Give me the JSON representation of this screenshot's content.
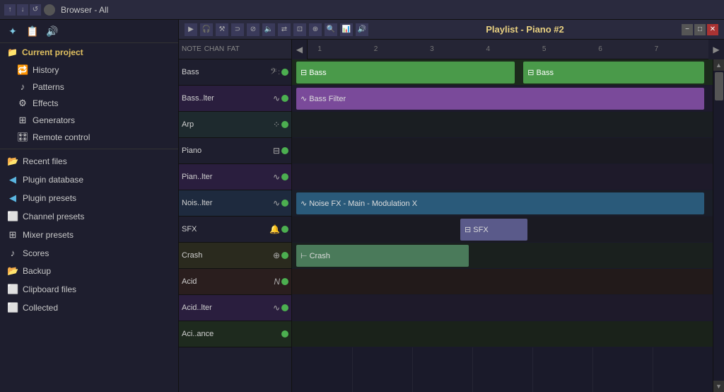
{
  "topbar": {
    "title": "Browser - All",
    "arrows": [
      "↑",
      "↓",
      "↺"
    ],
    "icons": [
      "⊕"
    ]
  },
  "sidebar": {
    "header_icons": [
      "✦",
      "📄",
      "🔊"
    ],
    "current_project_label": "Current project",
    "project_items": [
      {
        "label": "History",
        "icon": "🔁"
      },
      {
        "label": "Patterns",
        "icon": "♪"
      },
      {
        "label": "Effects",
        "icon": "⚙"
      },
      {
        "label": "Generators",
        "icon": "⊞"
      },
      {
        "label": "Remote control",
        "icon": "🎛"
      }
    ],
    "main_items": [
      {
        "label": "Recent files",
        "icon": "📂"
      },
      {
        "label": "Plugin database",
        "icon": "🔌"
      },
      {
        "label": "Plugin presets",
        "icon": "🔌"
      },
      {
        "label": "Channel presets",
        "icon": "⬜"
      },
      {
        "label": "Mixer presets",
        "icon": "⊞"
      },
      {
        "label": "Scores",
        "icon": "♪"
      },
      {
        "label": "Backup",
        "icon": "📂"
      },
      {
        "label": "Clipboard files",
        "icon": "⬜"
      },
      {
        "label": "Collected",
        "icon": "⬜"
      }
    ]
  },
  "playlist": {
    "title": "Playlist - Piano #2",
    "window_controls": [
      "-",
      "□",
      "✕"
    ],
    "ruler_marks": [
      "1",
      "2",
      "3",
      "4",
      "5",
      "6",
      "7"
    ],
    "ruler_mark_positions": [
      0,
      14.28,
      28.57,
      42.86,
      57.14,
      71.43,
      85.71
    ]
  },
  "tracks": [
    {
      "name": "Bass",
      "icon": "𝄢",
      "color": "#4a9a4a",
      "clips": [
        {
          "label": "⊟ Bass",
          "left_pct": 0,
          "width_pct": 55,
          "color": "#4a9a4a",
          "text_color": "#fff"
        },
        {
          "label": "⊟ Bass",
          "left_pct": 55,
          "width_pct": 45,
          "color": "#4a9a4a",
          "text_color": "#fff"
        }
      ]
    },
    {
      "name": "Bass..lter",
      "icon": "∿",
      "color": "#7a4a9a",
      "clips": [
        {
          "label": "∿ Bass Filter",
          "left_pct": 0,
          "width_pct": 100,
          "color": "#7a4a9a",
          "text_color": "#ddd"
        }
      ]
    },
    {
      "name": "Arp",
      "icon": "⁘",
      "color": "#1e2a2e",
      "clips": []
    },
    {
      "name": "Piano",
      "icon": "⊟",
      "color": "#4a4a9a",
      "clips": []
    },
    {
      "name": "Pian..lter",
      "icon": "∿",
      "color": "#2a1e3e",
      "clips": []
    },
    {
      "name": "Nois..lter",
      "icon": "∿",
      "color": "#2a4a6a",
      "clips": [
        {
          "label": "∿ Noise FX - Main - Modulation X",
          "left_pct": 0,
          "width_pct": 100,
          "color": "#2a5a7a",
          "text_color": "#ddd"
        }
      ]
    },
    {
      "name": "SFX",
      "icon": "🔔",
      "color": "#1e1e2e",
      "clips": [
        {
          "label": "⊟ SFX",
          "left_pct": 40,
          "width_pct": 18,
          "color": "#5a5a8a",
          "text_color": "#ddd"
        }
      ]
    },
    {
      "name": "Crash",
      "icon": "⊕",
      "color": "#1e2a2e",
      "clips": [
        {
          "label": "⊢ Crash",
          "left_pct": 0,
          "width_pct": 42,
          "color": "#4a7a7a",
          "text_color": "#ddd"
        }
      ]
    },
    {
      "name": "Acid",
      "icon": "∿",
      "color": "#2a1e1e",
      "clips": []
    },
    {
      "name": "Acid..lter",
      "icon": "∿",
      "color": "#2a1e3e",
      "clips": []
    },
    {
      "name": "Aci..ance",
      "icon": "",
      "color": "#1e2a1e",
      "clips": []
    }
  ]
}
